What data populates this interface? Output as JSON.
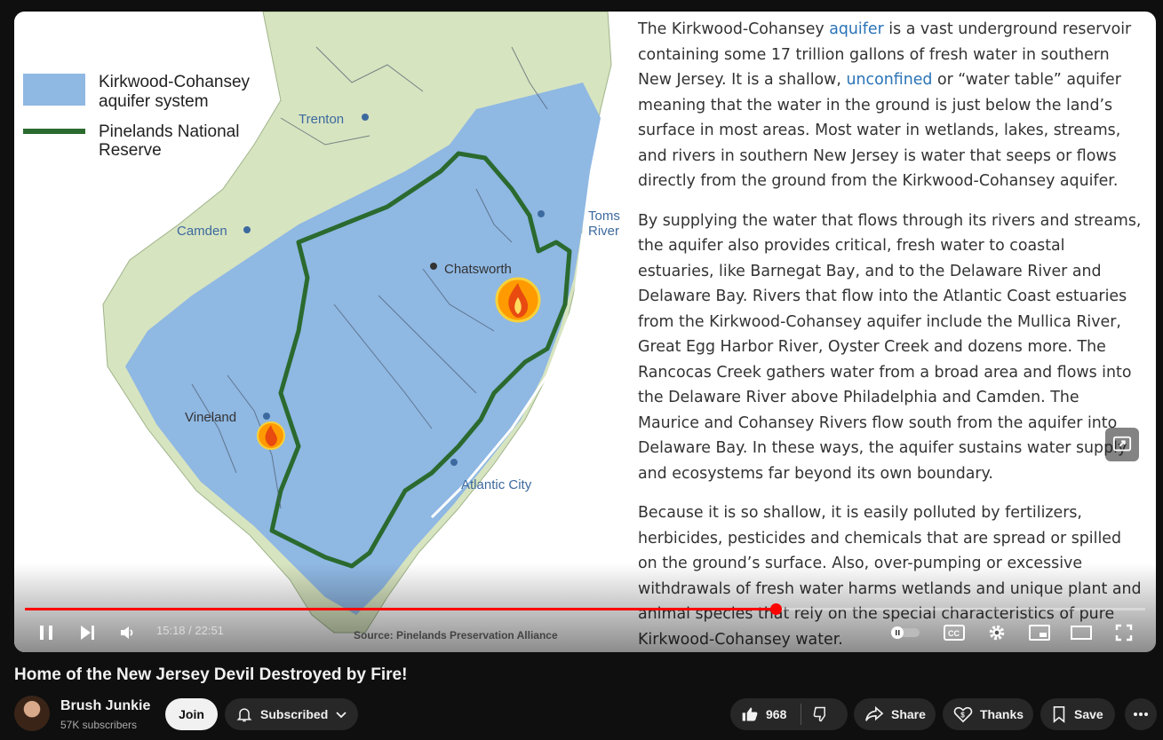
{
  "video": {
    "title": "Home of the New Jersey Devil Destroyed by Fire!",
    "time_current": "15:18",
    "time_total": "22:51",
    "time_display": "15:18 / 22:51",
    "progress": 0.67
  },
  "map": {
    "legend": {
      "aquifer_line1": "Kirkwood-Cohansey",
      "aquifer_line2": "aquifer system",
      "reserve_line1": "Pinelands National",
      "reserve_line2": "Reserve"
    },
    "places": {
      "trenton": "Trenton",
      "camden": "Camden",
      "chatsworth": "Chatsworth",
      "toms_river_1": "Toms",
      "toms_river_2": "River",
      "vineland": "Vineland",
      "atlantic_city": "Atlantic City"
    },
    "source": "Source: Pinelands Preservation Alliance",
    "colors": {
      "aquifer": "#8fb8e3",
      "land": "#d7e4c0",
      "reserve": "#2b6a2f",
      "fire": "#ff9a00"
    }
  },
  "article": {
    "p1_a": "The Kirkwood-Cohansey ",
    "p1_link1": "aquifer",
    "p1_b": " is a vast underground reservoir containing some 17 trillion gallons of fresh water in southern New Jersey.  It is a shallow, ",
    "p1_link2": "unconfined",
    "p1_c": " or “water table” aquifer meaning that the water in the ground is just below the land’s surface in most areas. Most water in wetlands, lakes, streams, and rivers in southern New Jersey is water that seeps or flows directly from the ground from the Kirkwood-Cohansey aquifer.",
    "p2": "By supplying the water that flows through its rivers and streams, the aquifer also provides critical, fresh water to coastal estuaries, like Barnegat Bay, and to the Delaware River and Delaware Bay. Rivers that flow into the Atlantic Coast estuaries from the Kirkwood-Cohansey aquifer include the Mullica River, Great Egg Harbor River, Oyster Creek and dozens more. The Rancocas Creek gathers water from a broad area and flows into the Delaware River above Philadelphia and Camden.  The Maurice and Cohansey Rivers flow south from the aquifer into Delaware Bay. In these ways, the aquifer sustains water supply and ecosystems far beyond its own boundary.",
    "p3": "Because it is so shallow, it is easily polluted by fertilizers, herbicides, pesticides and chemicals that are spread or spilled on the ground’s surface. Also, over-pumping or excessive withdrawals of fresh water harms wetlands and unique plant and animal species that rely on the special characteristics of pure Kirkwood-Cohansey water."
  },
  "channel": {
    "name": "Brush Junkie",
    "subscribers": "57K subscribers"
  },
  "actions": {
    "join": "Join",
    "subscribed": "Subscribed",
    "likes": "968",
    "share": "Share",
    "thanks": "Thanks",
    "save": "Save"
  },
  "icons": {
    "pause": "pause-icon",
    "next": "next-icon",
    "volume": "volume-icon",
    "autoplay": "autoplay-toggle-icon",
    "cc": "cc-icon",
    "settings": "gear-icon",
    "miniplayer": "miniplayer-icon",
    "theater": "theater-icon",
    "fullscreen": "fullscreen-icon",
    "bell": "bell-icon",
    "thumbs_up": "thumbs-up-icon",
    "thumbs_down": "thumbs-down-icon",
    "share": "share-icon",
    "thanks": "thanks-icon",
    "save": "bookmark-icon",
    "more": "more-icon"
  }
}
